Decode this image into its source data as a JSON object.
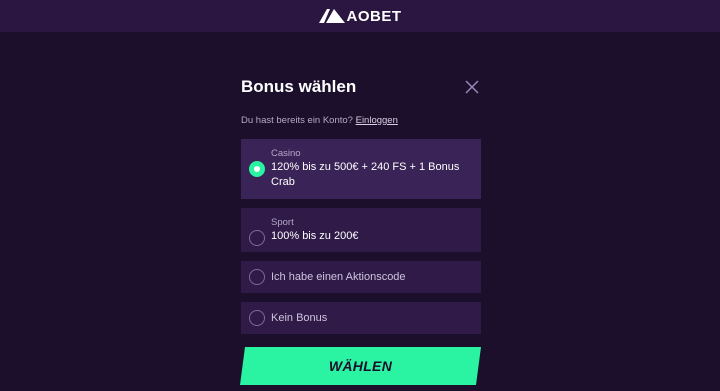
{
  "brand": {
    "name": "AOBET",
    "accent": "#2af3a2"
  },
  "modal": {
    "title": "Bonus wählen",
    "login_prompt": "Du hast bereits ein Konto?",
    "login_link": "Einloggen",
    "options": [
      {
        "category": "Casino",
        "description": "120% bis zu 500€ + 240 FS + 1 Bonus Crab",
        "selected": true
      },
      {
        "category": "Sport",
        "description": "100% bis zu 200€",
        "selected": false
      },
      {
        "label": "Ich habe einen Aktionscode",
        "selected": false
      },
      {
        "label": "Kein Bonus",
        "selected": false
      }
    ],
    "submit_label": "WÄHLEN"
  },
  "icons": {
    "close": "close-icon",
    "logo": "aobet-logo-icon"
  }
}
